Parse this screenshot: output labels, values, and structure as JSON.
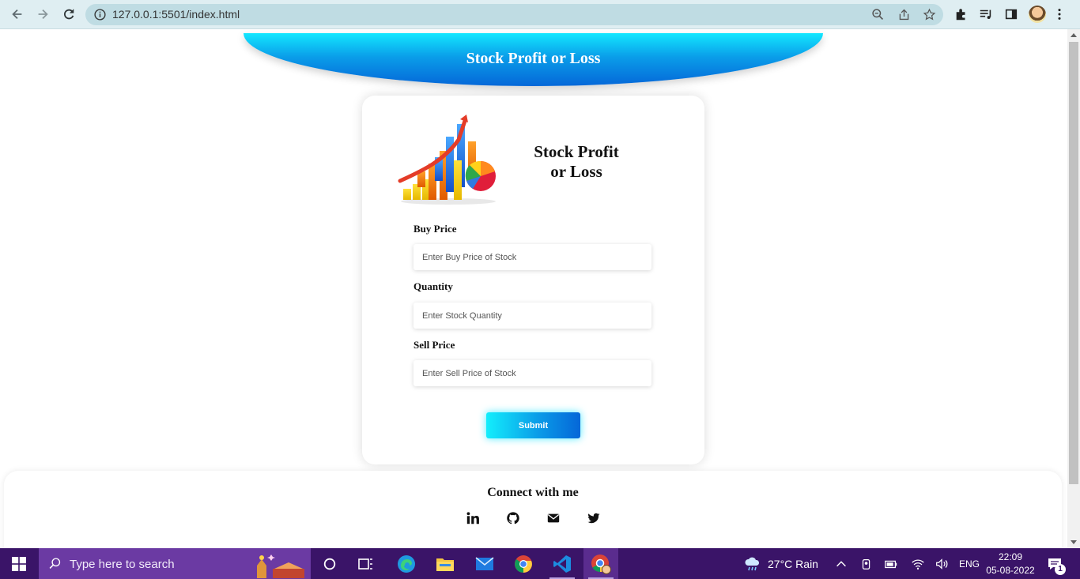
{
  "browser": {
    "url": "127.0.0.1:5501/index.html"
  },
  "page": {
    "header_title": "Stock Profit or Loss",
    "card_title": "Stock Profit or Loss",
    "fields": [
      {
        "label": "Buy Price",
        "placeholder": "Enter Buy Price of Stock",
        "value": ""
      },
      {
        "label": "Quantity",
        "placeholder": "Enter Stock Quantity",
        "value": ""
      },
      {
        "label": "Sell Price",
        "placeholder": "Enter Sell Price of Stock",
        "value": ""
      }
    ],
    "submit_label": "Submit",
    "footer": {
      "title": "Connect with me",
      "links": [
        "linkedin-icon",
        "github-icon",
        "mail-icon",
        "twitter-icon"
      ]
    }
  },
  "taskbar": {
    "search_placeholder": "Type here to search",
    "weather": "27°C  Rain",
    "language": "ENG",
    "time": "22:09",
    "date": "05-08-2022",
    "notification_count": "1"
  },
  "colors": {
    "accent_start": "#13e7ff",
    "accent_end": "#0567d8",
    "taskbar": "#3a1468"
  }
}
